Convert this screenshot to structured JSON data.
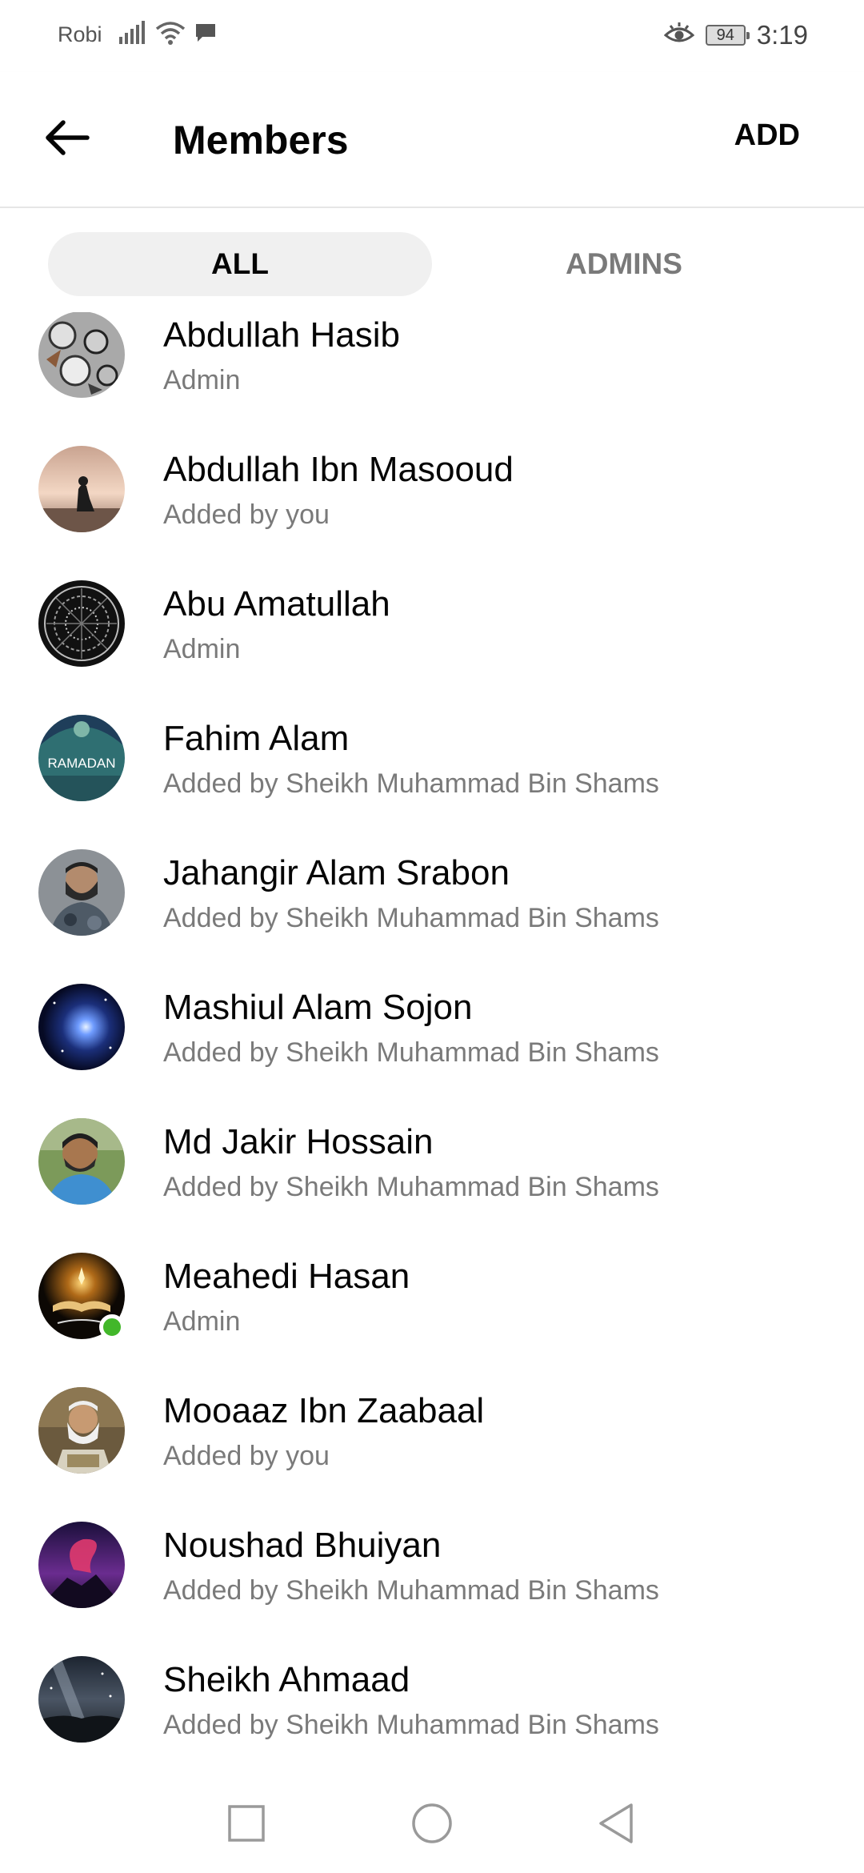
{
  "status_bar": {
    "carrier": "Robi",
    "battery": "94",
    "time": "3:19"
  },
  "header": {
    "title": "Members",
    "add_label": "ADD"
  },
  "tabs": [
    {
      "label": "ALL"
    },
    {
      "label": "ADMINS"
    }
  ],
  "members": [
    {
      "name": "Abdullah Hasib",
      "subtitle": "Admin",
      "avatar": "doodle-gray"
    },
    {
      "name": "Abdullah Ibn Masooud",
      "subtitle": "Added by you",
      "avatar": "sunset-prayer"
    },
    {
      "name": "Abu Amatullah",
      "subtitle": "Admin",
      "avatar": "dark-pattern"
    },
    {
      "name": "Fahim Alam",
      "subtitle": "Added by Sheikh Muhammad Bin Shams",
      "avatar": "ramadan-teal",
      "avatar_text": "RAMADAN"
    },
    {
      "name": "Jahangir Alam Srabon",
      "subtitle": "Added by Sheikh Muhammad Bin Shams",
      "avatar": "camo-man"
    },
    {
      "name": "Mashiul Alam Sojon",
      "subtitle": "Added by Sheikh Muhammad Bin Shams",
      "avatar": "galaxy-blue"
    },
    {
      "name": "Md Jakir Hossain",
      "subtitle": "Added by Sheikh Muhammad Bin Shams",
      "avatar": "outdoor-man"
    },
    {
      "name": "Meahedi Hasan",
      "subtitle": "Admin",
      "avatar": "quran-light",
      "online": true
    },
    {
      "name": "Mooaaz Ibn Zaabaal",
      "subtitle": "Added by you",
      "avatar": "elder-reading"
    },
    {
      "name": "Noushad Bhuiyan",
      "subtitle": "Added by Sheikh Muhammad Bin Shams",
      "avatar": "purple-nebula"
    },
    {
      "name": "Sheikh Ahmaad",
      "subtitle": "Added by Sheikh Muhammad Bin Shams",
      "avatar": "milky-way"
    }
  ],
  "colors": {
    "online": "#42b72a",
    "tab_active_bg": "#f0f0f0",
    "subtitle": "#7a7a7a"
  },
  "icons": {
    "back": "arrow-left-icon",
    "nav": [
      "recent-apps-icon",
      "home-icon",
      "back-triangle-icon"
    ]
  }
}
